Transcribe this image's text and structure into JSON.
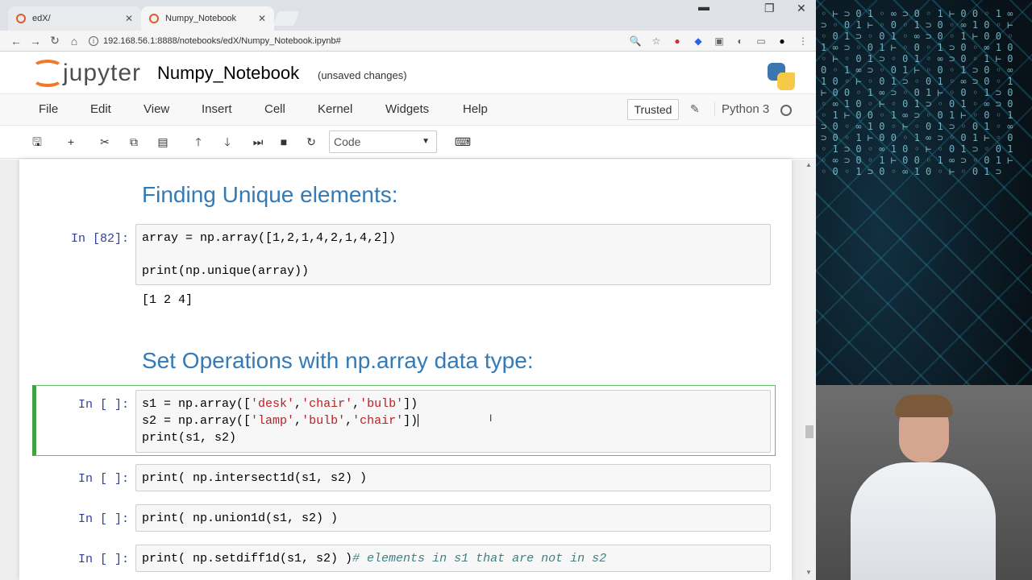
{
  "browser": {
    "tabs": [
      {
        "label": "edX/",
        "active": false
      },
      {
        "label": "Numpy_Notebook",
        "active": true
      }
    ],
    "url": "192.168.56.1:8888/notebooks/edX/Numpy_Notebook.ipynb#"
  },
  "jupyter": {
    "logo_text": "jupyter",
    "notebook_title": "Numpy_Notebook",
    "save_status": "(unsaved changes)",
    "menu": [
      "File",
      "Edit",
      "View",
      "Insert",
      "Cell",
      "Kernel",
      "Widgets",
      "Help"
    ],
    "trusted_label": "Trusted",
    "kernel_name": "Python 3",
    "cell_type": "Code"
  },
  "cells": {
    "heading1": "Finding Unique elements:",
    "cell1": {
      "prompt": "In [82]:",
      "line1": "array = np.array([1,2,1,4,2,1,4,2])",
      "line2": "print(np.unique(array))",
      "output": "[1 2 4]"
    },
    "heading2": "Set Operations with np.array data type:",
    "cell2": {
      "prompt": "In [ ]:",
      "l1_a": "s1 = np.array([",
      "l1_s1": "'desk'",
      "l1_c1": ",",
      "l1_s2": "'chair'",
      "l1_c2": ",",
      "l1_s3": "'bulb'",
      "l1_end": "])",
      "l2_a": "s2 = np.array([",
      "l2_s1": "'lamp'",
      "l2_c1": ",",
      "l2_s2": "'bulb'",
      "l2_c2": ",",
      "l2_s3": "'chair'",
      "l2_end": "])",
      "l3": "print(s1, s2)"
    },
    "cell3": {
      "prompt": "In [ ]:",
      "code": "print( np.intersect1d(s1, s2) )"
    },
    "cell4": {
      "prompt": "In [ ]:",
      "code": "print( np.union1d(s1, s2) )"
    },
    "cell5": {
      "prompt": "In [ ]:",
      "code": "print( np.setdiff1d(s1, s2) )",
      "comment": "# elements in s1 that are not in s2"
    }
  },
  "colors": {
    "accent": "#f37726",
    "heading": "#337ab7",
    "prompt": "#303f9f",
    "selected": "#42a047"
  }
}
